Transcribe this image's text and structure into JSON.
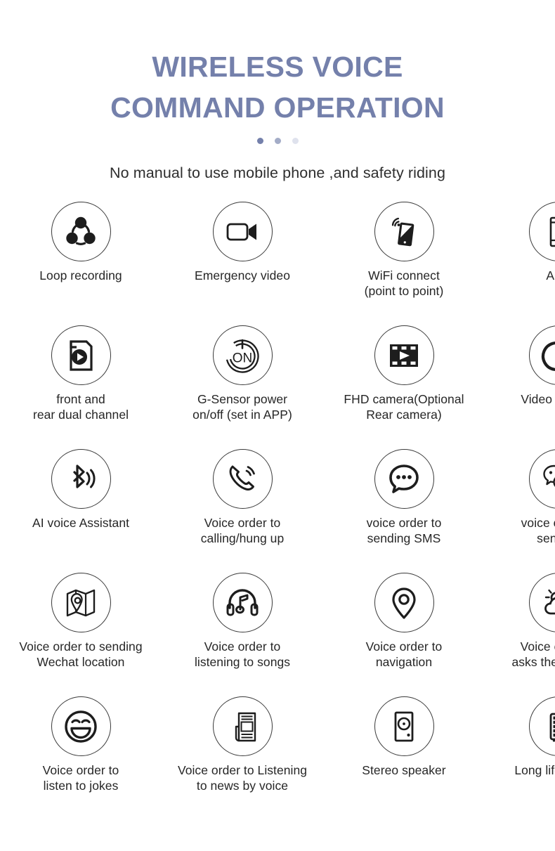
{
  "header": {
    "title_line1": "WIRELESS VOICE",
    "title_line2": "COMMAND OPERATION",
    "subtitle": "No manual to use mobile phone ,and safety riding",
    "title_color": "#7480ab",
    "dots": [
      {
        "name": "dot-active",
        "color": "#7480ab"
      },
      {
        "name": "dot-2",
        "color": "#a3acc7"
      },
      {
        "name": "dot-3",
        "color": "#dfe2ed"
      }
    ]
  },
  "features": [
    {
      "icon": "loop-recording-icon",
      "label": "Loop recording"
    },
    {
      "icon": "video-camera-icon",
      "label": "Emergency video"
    },
    {
      "icon": "wifi-phone-icon",
      "label": "WiFi connect\n(point to point)"
    },
    {
      "icon": "smartphone-icon",
      "label": "APP"
    },
    {
      "icon": "dual-channel-video-icon",
      "label": "front and\nrear dual channel"
    },
    {
      "icon": "power-on-icon",
      "label": "G-Sensor power\non/off  (set in APP)"
    },
    {
      "icon": "film-strip-icon",
      "label": "FHD camera(Optional\nRear camera)"
    },
    {
      "icon": "share-arrow-icon",
      "label": "Video sharing"
    },
    {
      "icon": "bluetooth-voice-icon",
      "label": "AI voice Assistant"
    },
    {
      "icon": "phone-call-icon",
      "label": "Voice order to\ncalling/hung up"
    },
    {
      "icon": "speech-bubble-icon",
      "label": "voice order to\nsending SMS"
    },
    {
      "icon": "wechat-icon",
      "label": "voice order to\nsending"
    },
    {
      "icon": "map-pin-icon",
      "label": "Voice order to sending\nWechat location"
    },
    {
      "icon": "headphones-music-icon",
      "label": "Voice order to\nlistening to songs"
    },
    {
      "icon": "location-pin-icon",
      "label": "Voice order to\nnavigation"
    },
    {
      "icon": "weather-sun-cloud-icon",
      "label": "Voice order to\nasks the weather"
    },
    {
      "icon": "smiley-face-icon",
      "label": "Voice order to\nlisten to jokes"
    },
    {
      "icon": "newspaper-icon",
      "label": "Voice order to Listening\nto news by voice"
    },
    {
      "icon": "speaker-icon",
      "label": "Stereo speaker"
    },
    {
      "icon": "battery-icon",
      "label": "Long life battery"
    }
  ]
}
